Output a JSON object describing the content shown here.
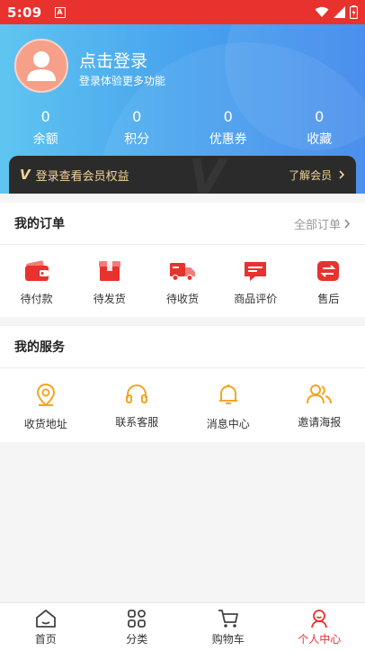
{
  "status_bar": {
    "time": "5:09",
    "notif_letter": "A"
  },
  "profile": {
    "login_title": "点击登录",
    "login_subtitle": "登录体验更多功能",
    "stats": [
      {
        "value": "0",
        "label": "余额"
      },
      {
        "value": "0",
        "label": "积分"
      },
      {
        "value": "0",
        "label": "优惠券"
      },
      {
        "value": "0",
        "label": "收藏"
      }
    ]
  },
  "member_bar": {
    "badge": "V",
    "text": "登录查看会员权益",
    "link": "了解会员"
  },
  "orders": {
    "title": "我的订单",
    "all_link": "全部订单",
    "items": [
      {
        "label": "待付款",
        "icon": "wallet-icon"
      },
      {
        "label": "待发货",
        "icon": "package-icon"
      },
      {
        "label": "待收货",
        "icon": "truck-icon"
      },
      {
        "label": "商品评价",
        "icon": "comment-icon"
      },
      {
        "label": "售后",
        "icon": "exchange-icon"
      }
    ]
  },
  "services": {
    "title": "我的服务",
    "items": [
      {
        "label": "收货地址",
        "icon": "location-icon"
      },
      {
        "label": "联系客服",
        "icon": "headset-icon"
      },
      {
        "label": "消息中心",
        "icon": "bell-icon"
      },
      {
        "label": "邀请海报",
        "icon": "people-icon"
      }
    ]
  },
  "tabbar": {
    "tabs": [
      {
        "label": "首页",
        "icon": "home-icon"
      },
      {
        "label": "分类",
        "icon": "category-icon"
      },
      {
        "label": "购物车",
        "icon": "cart-icon"
      },
      {
        "label": "个人中心",
        "icon": "profile-icon"
      }
    ],
    "active_index": 3
  },
  "colors": {
    "accent": "#e8322e",
    "service_icon": "#f4a523",
    "header_start": "#5fc5f0",
    "header_end": "#3e87ec"
  }
}
